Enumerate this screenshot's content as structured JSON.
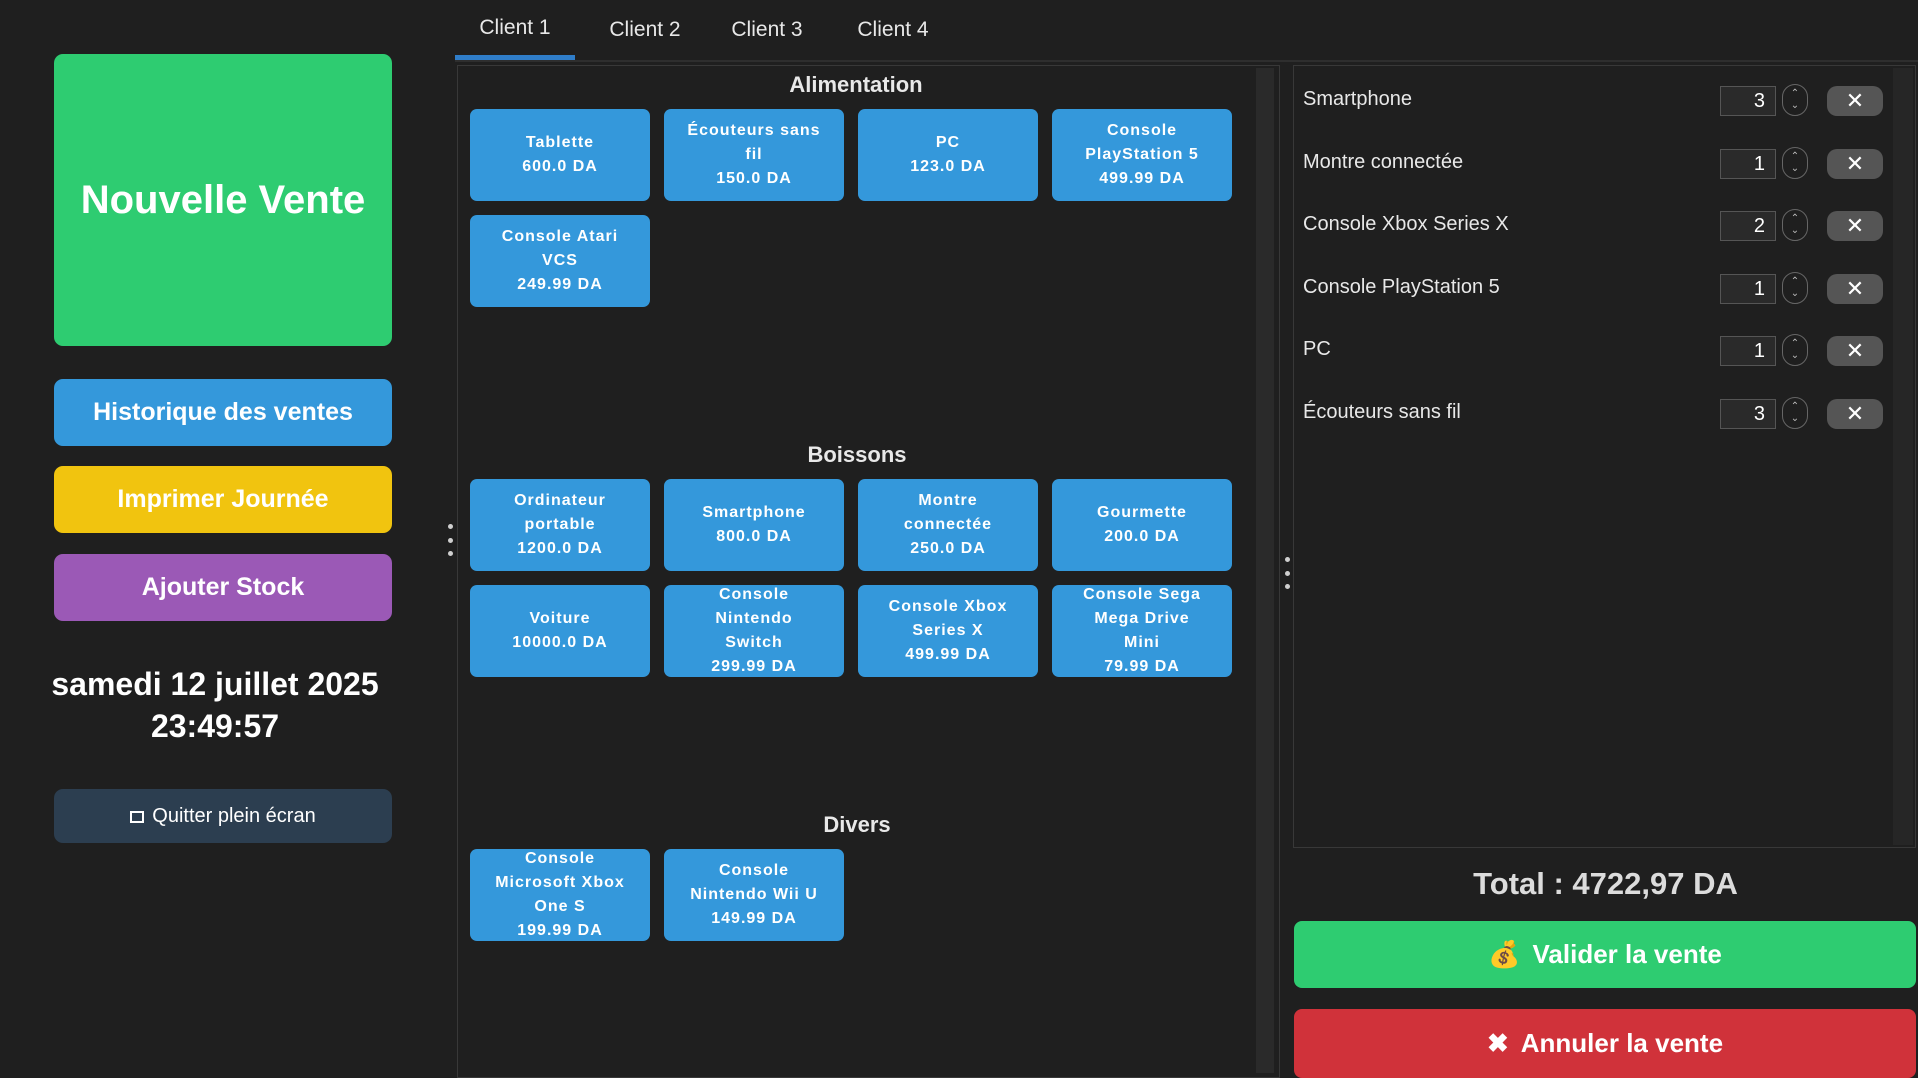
{
  "sidebar": {
    "new_sale": "Nouvelle Vente",
    "history": "Historique des ventes",
    "print_day": "Imprimer Journée",
    "add_stock": "Ajouter Stock",
    "date": "samedi 12 juillet 2025",
    "time": "23:49:57",
    "exit_fullscreen": "Quitter plein écran"
  },
  "tabs": [
    {
      "label": "Client 1",
      "active": true
    },
    {
      "label": "Client 2",
      "active": false
    },
    {
      "label": "Client 3",
      "active": false
    },
    {
      "label": "Client 4",
      "active": false
    }
  ],
  "categories": [
    {
      "name": "Alimentation",
      "products": [
        {
          "name": "Tablette",
          "price": "600.0 DA"
        },
        {
          "name": "Écouteurs sans fil",
          "price": "150.0 DA"
        },
        {
          "name": "PC",
          "price": "123.0 DA"
        },
        {
          "name": "Console PlayStation 5",
          "price": "499.99 DA"
        },
        {
          "name": "Console Atari VCS",
          "price": "249.99 DA"
        }
      ]
    },
    {
      "name": "Boissons",
      "products": [
        {
          "name": "Ordinateur portable",
          "price": "1200.0 DA"
        },
        {
          "name": "Smartphone",
          "price": "800.0 DA"
        },
        {
          "name": "Montre connectée",
          "price": "250.0 DA"
        },
        {
          "name": "Gourmette",
          "price": "200.0 DA"
        },
        {
          "name": "Voiture",
          "price": "10000.0 DA"
        },
        {
          "name": "Console Nintendo Switch",
          "price": "299.99 DA"
        },
        {
          "name": "Console Xbox Series X",
          "price": "499.99 DA"
        },
        {
          "name": "Console Sega Mega Drive Mini",
          "price": "79.99 DA"
        }
      ]
    },
    {
      "name": "Divers",
      "products": [
        {
          "name": "Console Microsoft Xbox One S",
          "price": "199.99 DA"
        },
        {
          "name": "Console Nintendo Wii U",
          "price": "149.99 DA"
        }
      ]
    }
  ],
  "cart": [
    {
      "name": "Smartphone",
      "qty": "3"
    },
    {
      "name": "Montre connectée",
      "qty": "1"
    },
    {
      "name": "Console Xbox Series X",
      "qty": "2"
    },
    {
      "name": "Console PlayStation 5",
      "qty": "1"
    },
    {
      "name": "PC",
      "qty": "1"
    },
    {
      "name": "Écouteurs sans fil",
      "qty": "3"
    }
  ],
  "total": "Total : 4722,97 DA",
  "actions": {
    "validate": "Valider la vente",
    "cancel": "Annuler la vente"
  },
  "colors": {
    "new_sale": "#2ecc71",
    "history": "#3498db",
    "print_day": "#f1c40f",
    "add_stock": "#9b59b6",
    "product": "#3498db",
    "validate": "#2ecc71",
    "cancel": "#d0323a"
  }
}
